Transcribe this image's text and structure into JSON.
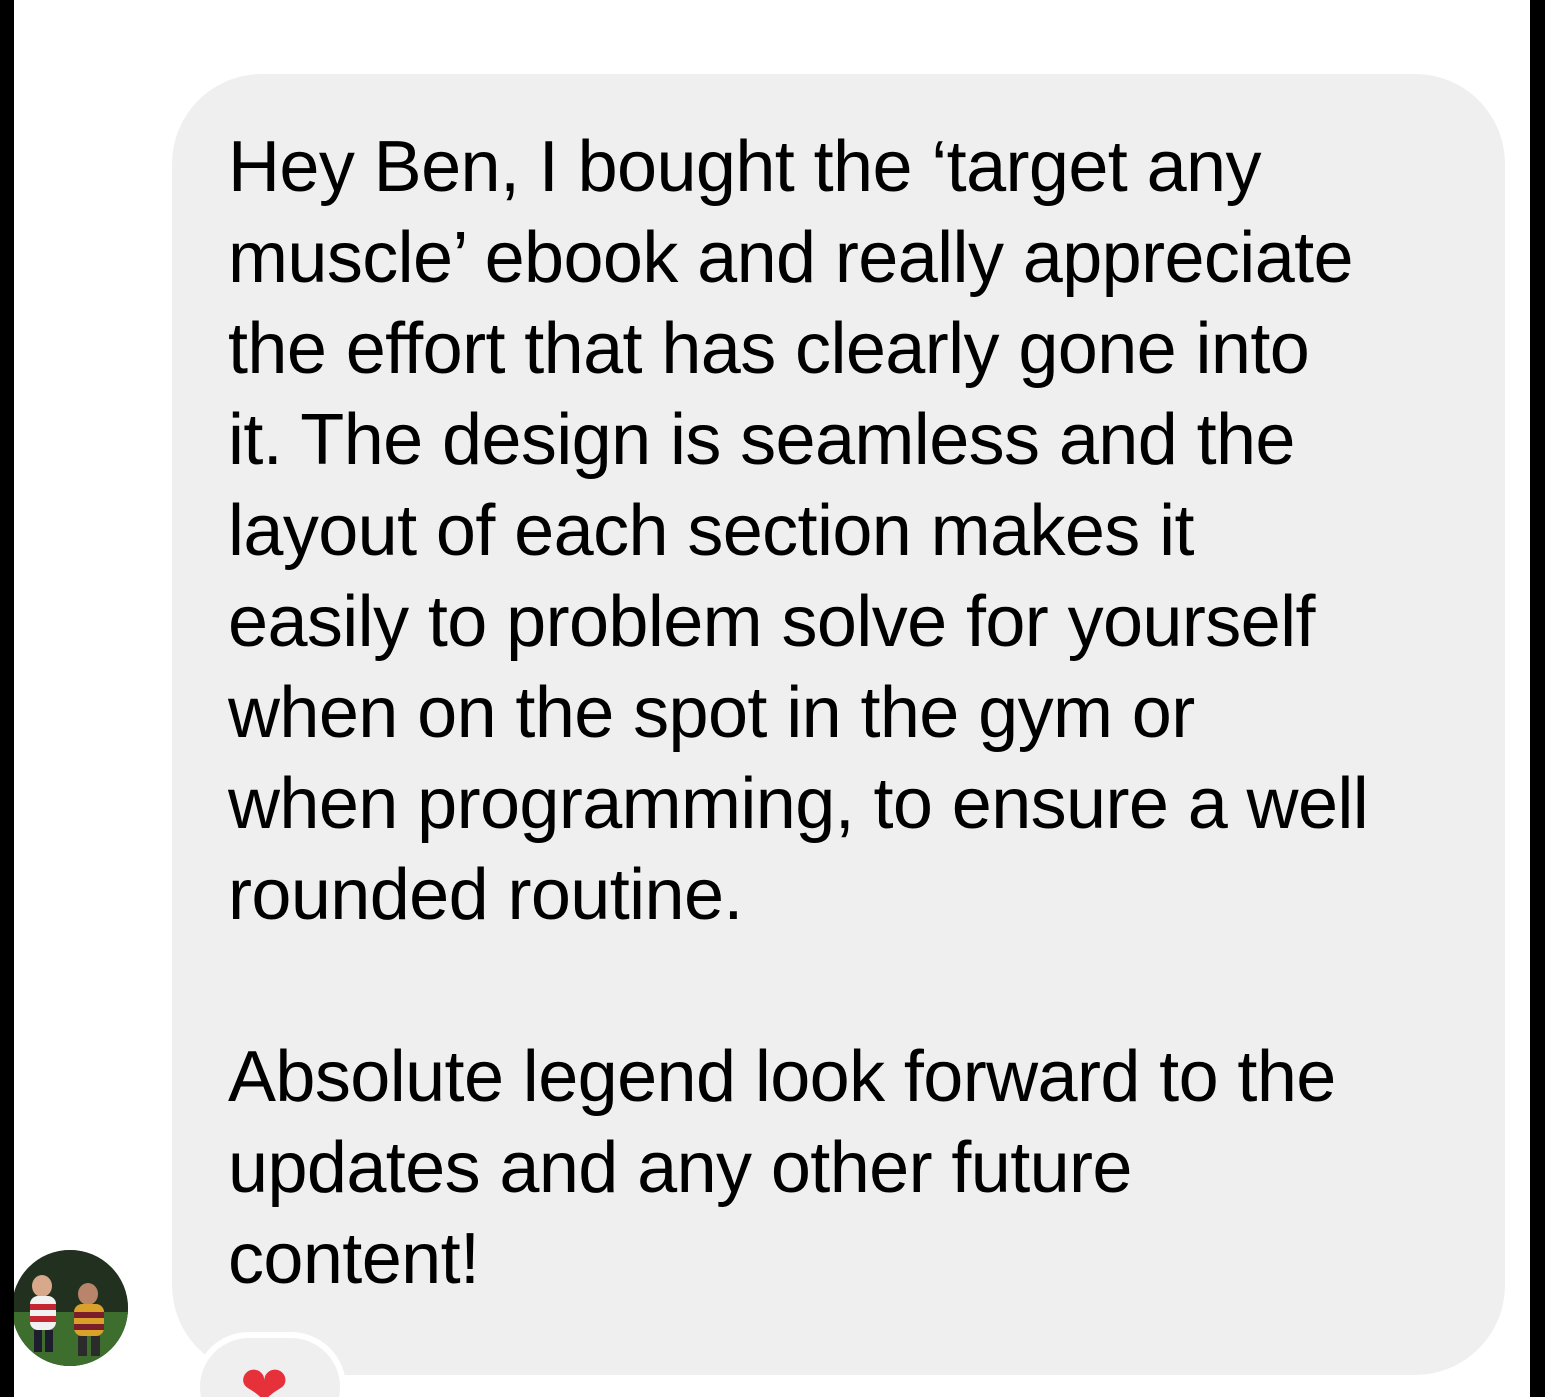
{
  "conversation": {
    "incoming_message": {
      "paragraphs": [
        "Hey Ben, I bought the ‘target any\nmuscle’ ebook and really appreciate\nthe effort that has clearly gone into\nit. The design is seamless and the\nlayout of each section makes it\neasily to problem solve for yourself\nwhen on the spot in the gym or\nwhen programming, to ensure a well\nrounded routine.",
        "Absolute legend look forward to the\nupdates and any other future\ncontent!"
      ],
      "reaction": {
        "icon": "heart-icon",
        "glyph": "❤",
        "color": "#e6313a"
      }
    },
    "sender_avatar": {
      "icon": "avatar-photo",
      "colors": {
        "grass": "#3d6e2e",
        "dark": "#22301f",
        "jersey_red": "#c4272f",
        "jersey_gold": "#d9a12a",
        "shirt_white": "#f2f2f2"
      }
    },
    "bubble_color": "#efefef"
  }
}
